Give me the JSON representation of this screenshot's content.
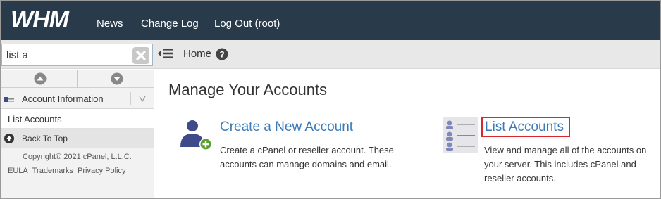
{
  "topbar": {
    "logo_text": "WHM",
    "nav": [
      "News",
      "Change Log",
      "Log Out (root)"
    ]
  },
  "search": {
    "value": "list a"
  },
  "breadcrumb": {
    "home_label": "Home"
  },
  "sidebar": {
    "category_label": "Account Information",
    "items": [
      "List Accounts"
    ],
    "back_to_top": "Back To Top",
    "copyright_prefix": "Copyright© 2021 ",
    "copyright_company": "cPanel, L.L.C.",
    "footer_links": [
      "EULA",
      "Trademarks",
      "Privacy Policy"
    ]
  },
  "main": {
    "page_title": "Manage Your Accounts",
    "cards": [
      {
        "title": "Create a New Account",
        "description": "Create a cPanel or reseller account. These accounts can manage domains and email."
      },
      {
        "title": "List Accounts",
        "description": "View and manage all of the accounts on your server. This includes cPanel and reseller accounts."
      }
    ]
  },
  "colors": {
    "topbar_bg": "#293a4a",
    "link_blue": "#3b7ab8",
    "highlight_red": "#d9262f",
    "add_green": "#5aa02c",
    "user_icon_navy": "#3f4a8a"
  }
}
